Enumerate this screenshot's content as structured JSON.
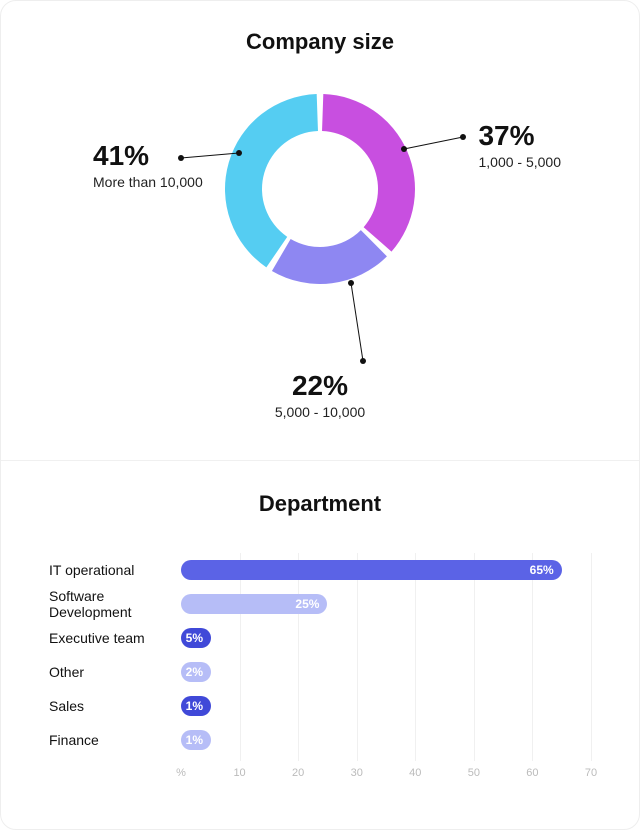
{
  "chart_data": [
    {
      "type": "pie",
      "title": "Company size",
      "series": [
        {
          "name": "1,000 - 5,000",
          "value": 37,
          "color": "#c84fe0"
        },
        {
          "name": "5,000 - 10,000",
          "value": 22,
          "color": "#8e87f2"
        },
        {
          "name": "More than 10,000",
          "value": 41,
          "color": "#55cdf2"
        }
      ],
      "labels": {
        "right": {
          "pct": "37%",
          "sub": "1,000 - 5,000"
        },
        "bottom": {
          "pct": "22%",
          "sub": "5,000 - 10,000"
        },
        "left": {
          "pct": "41%",
          "sub": "More than 10,000"
        }
      }
    },
    {
      "type": "bar",
      "title": "Department",
      "xlabel": "",
      "ylabel": "",
      "xlim": [
        0,
        70
      ],
      "ticks": [
        "%",
        "10",
        "20",
        "30",
        "40",
        "50",
        "60",
        "70"
      ],
      "categories": [
        "IT operational",
        "Software Development",
        "Executive team",
        "Other",
        "Sales",
        "Finance"
      ],
      "values": [
        65,
        25,
        5,
        2,
        1,
        1
      ],
      "value_labels": [
        "65%",
        "25%",
        "5%",
        "2%",
        "1%",
        "1%"
      ],
      "colors": [
        "#5b63e6",
        "#b6bdf7",
        "#4049d8",
        "#b6bdf7",
        "#4049d8",
        "#b6bdf7"
      ]
    }
  ]
}
